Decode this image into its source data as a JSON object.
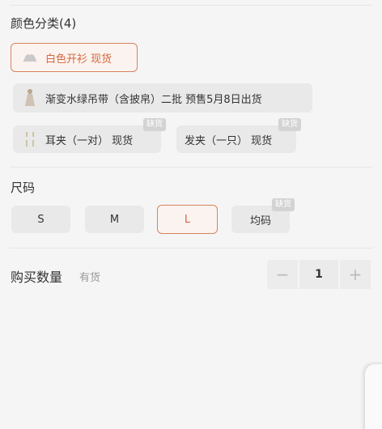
{
  "color_section": {
    "title": "颜色分类(4)",
    "options": [
      {
        "label": "白色开衫 现货",
        "icon": "cardigan-thumbnail-icon",
        "selected": true,
        "out_of_stock": false
      },
      {
        "label": "渐变水绿吊带（含披帛）二批 预售5月8日出货",
        "icon": "dress-thumbnail-icon",
        "selected": false,
        "out_of_stock": false
      },
      {
        "label": "耳夹（一对） 现货",
        "icon": "earring-thumbnail-icon",
        "selected": false,
        "out_of_stock": true
      },
      {
        "label": "发夹（一只） 现货",
        "icon": "",
        "selected": false,
        "out_of_stock": true
      }
    ]
  },
  "size_section": {
    "title": "尺码",
    "options": [
      {
        "label": "S",
        "selected": false,
        "out_of_stock": false
      },
      {
        "label": "M",
        "selected": false,
        "out_of_stock": false
      },
      {
        "label": "L",
        "selected": true,
        "out_of_stock": false
      },
      {
        "label": "均码",
        "selected": false,
        "out_of_stock": true
      }
    ]
  },
  "out_of_stock_tag": "缺货",
  "quantity_section": {
    "title": "购买数量",
    "stock_status": "有货",
    "value": "1",
    "decrement_symbol": "−",
    "increment_symbol": "+"
  },
  "colors": {
    "accent": "#d4683f",
    "selected_border": "#d9825f",
    "chip_bg": "#e9e9e9",
    "page_bg": "#f5f5f5"
  }
}
